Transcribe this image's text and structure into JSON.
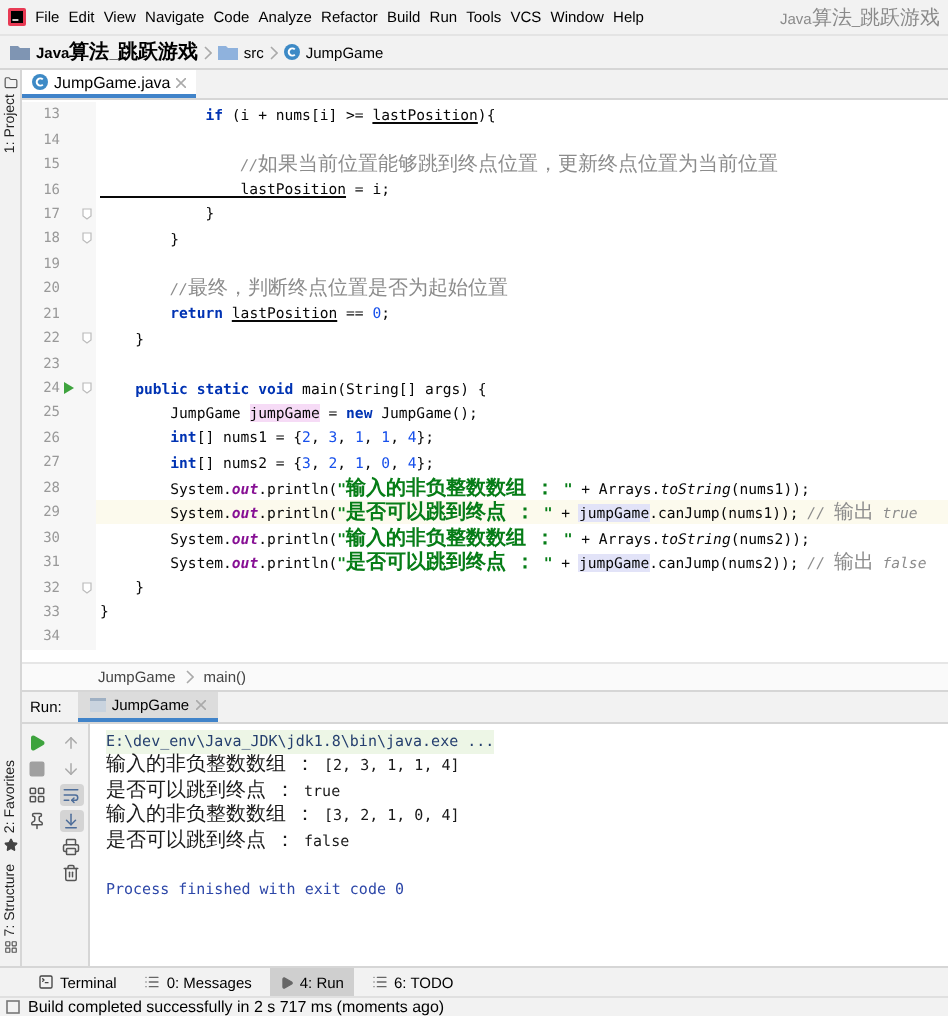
{
  "menu_bar": {
    "items": [
      "File",
      "Edit",
      "View",
      "Navigate",
      "Code",
      "Analyze",
      "Refactor",
      "Build",
      "Run",
      "Tools",
      "VCS",
      "Window",
      "Help"
    ],
    "title": "Java算法_跳跃游戏"
  },
  "breadcrumb": [
    {
      "kind": "project",
      "label": "Java算法_跳跃游戏"
    },
    {
      "kind": "folder",
      "label": "src"
    },
    {
      "kind": "class",
      "label": "JumpGame"
    }
  ],
  "side_tool_windows": [
    {
      "kind": "project",
      "label": "1: Project"
    },
    {
      "kind": "favorites",
      "label": "2: Favorites"
    },
    {
      "kind": "structure",
      "label": "7: Structure"
    }
  ],
  "editor_tabs": [
    {
      "label": "JumpGame.java",
      "selected": true
    }
  ],
  "code_lines": [
    {
      "number": "13",
      "current": false,
      "run_marker": false,
      "fold_marker": false,
      "segments": [
        {
          "kind": "keyword",
          "text": "            if"
        },
        {
          "kind": "plain",
          "text": " (i + nums[i] >= "
        },
        {
          "kind": "variable",
          "text": "lastPosition"
        },
        {
          "kind": "plain",
          "text": "){"
        }
      ]
    },
    {
      "number": "14",
      "current": false,
      "run_marker": false,
      "fold_marker": false
    },
    {
      "number": "15",
      "current": false,
      "run_marker": false,
      "fold_marker": false,
      "segments": [
        {
          "kind": "comment",
          "text": "                //如果当前位置能够跳到终点位置，更新终点位置为当前位置"
        }
      ]
    },
    {
      "number": "16",
      "current": false,
      "run_marker": false,
      "fold_marker": false,
      "segments": [
        {
          "kind": "variable",
          "text": "                lastPosition"
        },
        {
          "kind": "plain",
          "text": " = i;"
        }
      ]
    },
    {
      "number": "17",
      "current": false,
      "run_marker": false,
      "fold_marker": true,
      "segments": [
        {
          "kind": "plain",
          "text": "            }"
        }
      ]
    },
    {
      "number": "18",
      "current": false,
      "run_marker": false,
      "fold_marker": true,
      "segments": [
        {
          "kind": "plain",
          "text": "        }"
        }
      ]
    },
    {
      "number": "19",
      "current": false,
      "run_marker": false,
      "fold_marker": false
    },
    {
      "number": "20",
      "current": false,
      "run_marker": false,
      "fold_marker": false,
      "segments": [
        {
          "kind": "comment",
          "text": "        //最终，判断终点位置是否为起始位置"
        }
      ]
    },
    {
      "number": "21",
      "current": false,
      "run_marker": false,
      "fold_marker": false,
      "segments": [
        {
          "kind": "keyword",
          "text": "        return "
        },
        {
          "kind": "variable",
          "text": "lastPosition"
        },
        {
          "kind": "plain",
          "text": " == "
        },
        {
          "kind": "number",
          "text": "0"
        },
        {
          "kind": "plain",
          "text": ";"
        }
      ]
    },
    {
      "number": "22",
      "current": false,
      "run_marker": false,
      "fold_marker": true,
      "segments": [
        {
          "kind": "plain",
          "text": "    }"
        }
      ]
    },
    {
      "number": "23",
      "current": false,
      "run_marker": false,
      "fold_marker": false
    },
    {
      "number": "24",
      "current": false,
      "run_marker": true,
      "fold_marker": true,
      "segments": [
        {
          "kind": "keyword",
          "text": "    public static void"
        },
        {
          "kind": "plain",
          "text": " main(String[] args) {"
        }
      ]
    },
    {
      "number": "25",
      "current": false,
      "run_marker": false,
      "fold_marker": false,
      "segments": [
        {
          "kind": "plain",
          "text": "        JumpGame "
        },
        {
          "kind": "declaration",
          "text": "jumpGame"
        },
        {
          "kind": "plain",
          "text": " = "
        },
        {
          "kind": "keyword",
          "text": "new"
        },
        {
          "kind": "plain",
          "text": " JumpGame();"
        }
      ]
    },
    {
      "number": "26",
      "current": false,
      "run_marker": false,
      "fold_marker": false,
      "segments": [
        {
          "kind": "keyword",
          "text": "        int"
        },
        {
          "kind": "plain",
          "text": "[] nums1 = {"
        },
        {
          "kind": "number",
          "text": "2"
        },
        {
          "kind": "plain",
          "text": ", "
        },
        {
          "kind": "number",
          "text": "3"
        },
        {
          "kind": "plain",
          "text": ", "
        },
        {
          "kind": "number",
          "text": "1"
        },
        {
          "kind": "plain",
          "text": ", "
        },
        {
          "kind": "number",
          "text": "1"
        },
        {
          "kind": "plain",
          "text": ", "
        },
        {
          "kind": "number",
          "text": "4"
        },
        {
          "kind": "plain",
          "text": "};"
        }
      ]
    },
    {
      "number": "27",
      "current": false,
      "run_marker": false,
      "fold_marker": false,
      "segments": [
        {
          "kind": "keyword",
          "text": "        int"
        },
        {
          "kind": "plain",
          "text": "[] nums2 = {"
        },
        {
          "kind": "number",
          "text": "3"
        },
        {
          "kind": "plain",
          "text": ", "
        },
        {
          "kind": "number",
          "text": "2"
        },
        {
          "kind": "plain",
          "text": ", "
        },
        {
          "kind": "number",
          "text": "1"
        },
        {
          "kind": "plain",
          "text": ", "
        },
        {
          "kind": "number",
          "text": "0"
        },
        {
          "kind": "plain",
          "text": ", "
        },
        {
          "kind": "number",
          "text": "4"
        },
        {
          "kind": "plain",
          "text": "};"
        }
      ]
    },
    {
      "number": "28",
      "current": false,
      "run_marker": false,
      "fold_marker": false,
      "segments": [
        {
          "kind": "plain",
          "text": "        System."
        },
        {
          "kind": "field",
          "text": "out"
        },
        {
          "kind": "plain",
          "text": ".println("
        },
        {
          "kind": "string",
          "text": "\"输入的非负整数数组 ： \""
        },
        {
          "kind": "plain",
          "text": " + Arrays."
        },
        {
          "kind": "static_method",
          "text": "toString"
        },
        {
          "kind": "plain",
          "text": "(nums1));"
        }
      ]
    },
    {
      "number": "29",
      "current": true,
      "run_marker": false,
      "fold_marker": false,
      "segments": [
        {
          "kind": "plain",
          "text": "        System."
        },
        {
          "kind": "field",
          "text": "out"
        },
        {
          "kind": "plain",
          "text": ".println("
        },
        {
          "kind": "string",
          "text": "\"是否可以跳到终点 ： \""
        },
        {
          "kind": "plain",
          "text": " + "
        },
        {
          "kind": "usage",
          "text": "jumpGame"
        },
        {
          "kind": "plain",
          "text": ".canJump(nums1)); "
        },
        {
          "kind": "comment",
          "text": "// 输出 true"
        }
      ]
    },
    {
      "number": "30",
      "current": false,
      "run_marker": false,
      "fold_marker": false,
      "segments": [
        {
          "kind": "plain",
          "text": "        System."
        },
        {
          "kind": "field",
          "text": "out"
        },
        {
          "kind": "plain",
          "text": ".println("
        },
        {
          "kind": "string",
          "text": "\"输入的非负整数数组 ： \""
        },
        {
          "kind": "plain",
          "text": " + Arrays."
        },
        {
          "kind": "static_method",
          "text": "toString"
        },
        {
          "kind": "plain",
          "text": "(nums2));"
        }
      ]
    },
    {
      "number": "31",
      "current": false,
      "run_marker": false,
      "fold_marker": false,
      "segments": [
        {
          "kind": "plain",
          "text": "        System."
        },
        {
          "kind": "field",
          "text": "out"
        },
        {
          "kind": "plain",
          "text": ".println("
        },
        {
          "kind": "string",
          "text": "\"是否可以跳到终点 ： \""
        },
        {
          "kind": "plain",
          "text": " + "
        },
        {
          "kind": "usage",
          "text": "jumpGame"
        },
        {
          "kind": "plain",
          "text": ".canJump(nums2)); "
        },
        {
          "kind": "comment",
          "text": "// 输出 false"
        }
      ]
    },
    {
      "number": "32",
      "current": false,
      "run_marker": false,
      "fold_marker": true,
      "segments": [
        {
          "kind": "plain",
          "text": "    }"
        }
      ]
    },
    {
      "number": "33",
      "current": false,
      "run_marker": false,
      "fold_marker": false,
      "segments": [
        {
          "kind": "plain",
          "text": "}"
        }
      ]
    },
    {
      "number": "34",
      "current": false,
      "run_marker": false,
      "fold_marker": false
    }
  ],
  "editor_breadcrumb": [
    "JumpGame",
    "main()"
  ],
  "run_panel": {
    "label": "Run:",
    "tabs": [
      {
        "label": "JumpGame",
        "selected": true
      }
    ],
    "toolbar_left": [
      {
        "kind": "run",
        "selected": false
      },
      {
        "kind": "stop",
        "selected": false
      },
      {
        "kind": "layout",
        "selected": false
      },
      {
        "kind": "pin",
        "selected": false
      }
    ],
    "toolbar_right": [
      {
        "kind": "up",
        "selected": false
      },
      {
        "kind": "down",
        "selected": false
      },
      {
        "kind": "wrap",
        "selected": true
      },
      {
        "kind": "scroll_end",
        "selected": true
      },
      {
        "kind": "print",
        "selected": false
      },
      {
        "kind": "delete",
        "selected": false
      }
    ],
    "console": [
      {
        "kind": "command",
        "text": "E:\\dev_env\\Java_JDK\\jdk1.8\\bin\\java.exe ..."
      },
      {
        "kind": "output",
        "text": "输入的非负整数数组 ： [2, 3, 1, 1, 4]"
      },
      {
        "kind": "output",
        "text": "是否可以跳到终点 ： true"
      },
      {
        "kind": "output",
        "text": "输入的非负整数数组 ： [3, 2, 1, 0, 4]"
      },
      {
        "kind": "output",
        "text": "是否可以跳到终点 ： false"
      },
      {
        "kind": "exit",
        "text": "Process finished with exit code 0"
      }
    ]
  },
  "bottom_tabs": [
    {
      "kind": "terminal",
      "label": "Terminal",
      "selected": false
    },
    {
      "kind": "messages",
      "label": "0: Messages",
      "selected": false
    },
    {
      "kind": "run",
      "label": "4: Run",
      "selected": true
    },
    {
      "kind": "todo",
      "label": "6: TODO",
      "selected": false
    }
  ],
  "status_bar": {
    "message": "Build completed successfully in 2 s 717 ms (moments ago)"
  }
}
